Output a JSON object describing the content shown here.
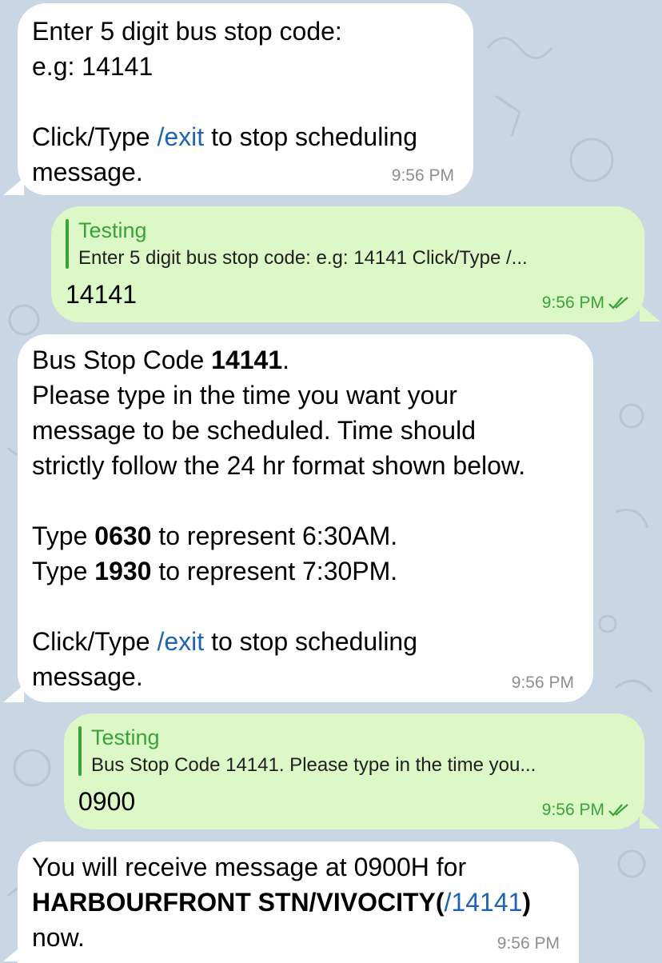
{
  "messages": [
    {
      "lines": [
        [
          {
            "t": "Enter 5 digit bus stop code:"
          }
        ],
        [
          {
            "t": "e.g: 14141"
          }
        ],
        [],
        [
          {
            "t": "Click/Type "
          },
          {
            "t": "/exit",
            "s": "link"
          },
          {
            "t": " to stop scheduling"
          }
        ],
        [
          {
            "t": "message."
          }
        ]
      ],
      "time": "9:56 PM"
    },
    {
      "reply_name": "Testing",
      "reply_text": "Enter 5 digit bus stop code: e.g: 14141 Click/Type /...",
      "text": "14141",
      "time": "9:56 PM"
    },
    {
      "lines": [
        [
          {
            "t": "Bus Stop Code "
          },
          {
            "t": "14141",
            "s": "b"
          },
          {
            "t": "."
          }
        ],
        [
          {
            "t": "Please type in the time you want your"
          }
        ],
        [
          {
            "t": "message to be scheduled. Time should"
          }
        ],
        [
          {
            "t": "strictly follow the 24 hr format shown below."
          }
        ],
        [],
        [
          {
            "t": "Type "
          },
          {
            "t": "0630",
            "s": "b"
          },
          {
            "t": " to represent 6:30AM."
          }
        ],
        [
          {
            "t": "Type "
          },
          {
            "t": "1930",
            "s": "b"
          },
          {
            "t": " to represent 7:30PM."
          }
        ],
        [],
        [
          {
            "t": "Click/Type "
          },
          {
            "t": "/exit",
            "s": "link"
          },
          {
            "t": " to stop scheduling"
          }
        ],
        [
          {
            "t": "message."
          }
        ]
      ],
      "time": "9:56 PM"
    },
    {
      "reply_name": "Testing",
      "reply_text": "Bus Stop Code 14141. Please type in the time you...",
      "text": "0900",
      "time": "9:56 PM"
    },
    {
      "lines": [
        [
          {
            "t": "You will receive message at 0900H for"
          }
        ],
        [
          {
            "t": "HARBOURFRONT STN/VIVOCITY(",
            "s": "b"
          },
          {
            "t": "/14141",
            "s": "link"
          },
          {
            "t": ")",
            "s": "b"
          }
        ],
        [
          {
            "t": "now."
          }
        ]
      ],
      "time": "9:56 PM"
    }
  ],
  "colors": {
    "background": "#c9d6e4",
    "incoming_bubble": "#ffffff",
    "outgoing_bubble": "#dcf8c6",
    "link": "#1e63b4",
    "outgoing_accent": "#3aa23a",
    "timestamp_gray": "#8b8f93"
  },
  "icons": [
    "double-check-icon"
  ]
}
